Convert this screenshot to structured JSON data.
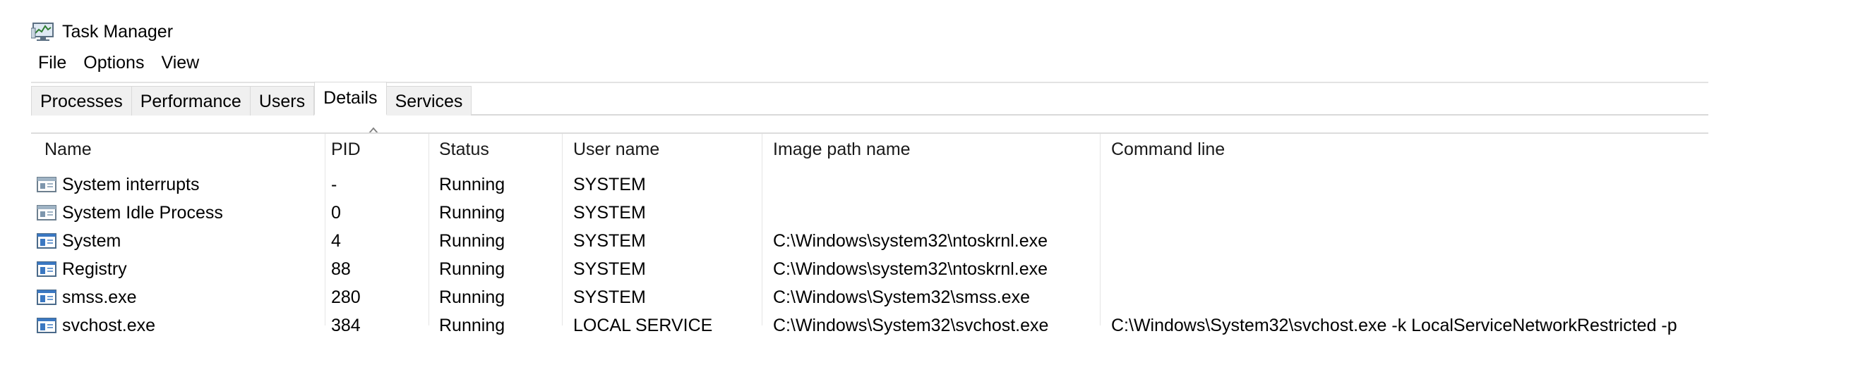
{
  "window": {
    "title": "Task Manager"
  },
  "menu": [
    "File",
    "Options",
    "View"
  ],
  "tabs": [
    {
      "label": "Processes",
      "active": false
    },
    {
      "label": "Performance",
      "active": false
    },
    {
      "label": "Users",
      "active": false
    },
    {
      "label": "Details",
      "active": true
    },
    {
      "label": "Services",
      "active": false
    }
  ],
  "table": {
    "sorted_column": "PID",
    "columns": [
      "Name",
      "PID",
      "Status",
      "User name",
      "Image path name",
      "Command line"
    ],
    "rows": [
      {
        "name": "System interrupts",
        "pid": "-",
        "status": "Running",
        "user": "SYSTEM",
        "image_path": "",
        "command_line": "",
        "icon": "system-process-icon"
      },
      {
        "name": "System Idle Process",
        "pid": "0",
        "status": "Running",
        "user": "SYSTEM",
        "image_path": "",
        "command_line": "",
        "icon": "system-process-icon"
      },
      {
        "name": "System",
        "pid": "4",
        "status": "Running",
        "user": "SYSTEM",
        "image_path": "C:\\Windows\\system32\\ntoskrnl.exe",
        "command_line": "",
        "icon": "application-process-icon"
      },
      {
        "name": "Registry",
        "pid": "88",
        "status": "Running",
        "user": "SYSTEM",
        "image_path": "C:\\Windows\\system32\\ntoskrnl.exe",
        "command_line": "",
        "icon": "application-process-icon"
      },
      {
        "name": "smss.exe",
        "pid": "280",
        "status": "Running",
        "user": "SYSTEM",
        "image_path": "C:\\Windows\\System32\\smss.exe",
        "command_line": "",
        "icon": "application-process-icon"
      },
      {
        "name": "svchost.exe",
        "pid": "384",
        "status": "Running",
        "user": "LOCAL SERVICE",
        "image_path": "C:\\Windows\\System32\\svchost.exe",
        "command_line": "C:\\Windows\\System32\\svchost.exe -k LocalServiceNetworkRestricted -p",
        "icon": "application-process-icon"
      }
    ]
  }
}
